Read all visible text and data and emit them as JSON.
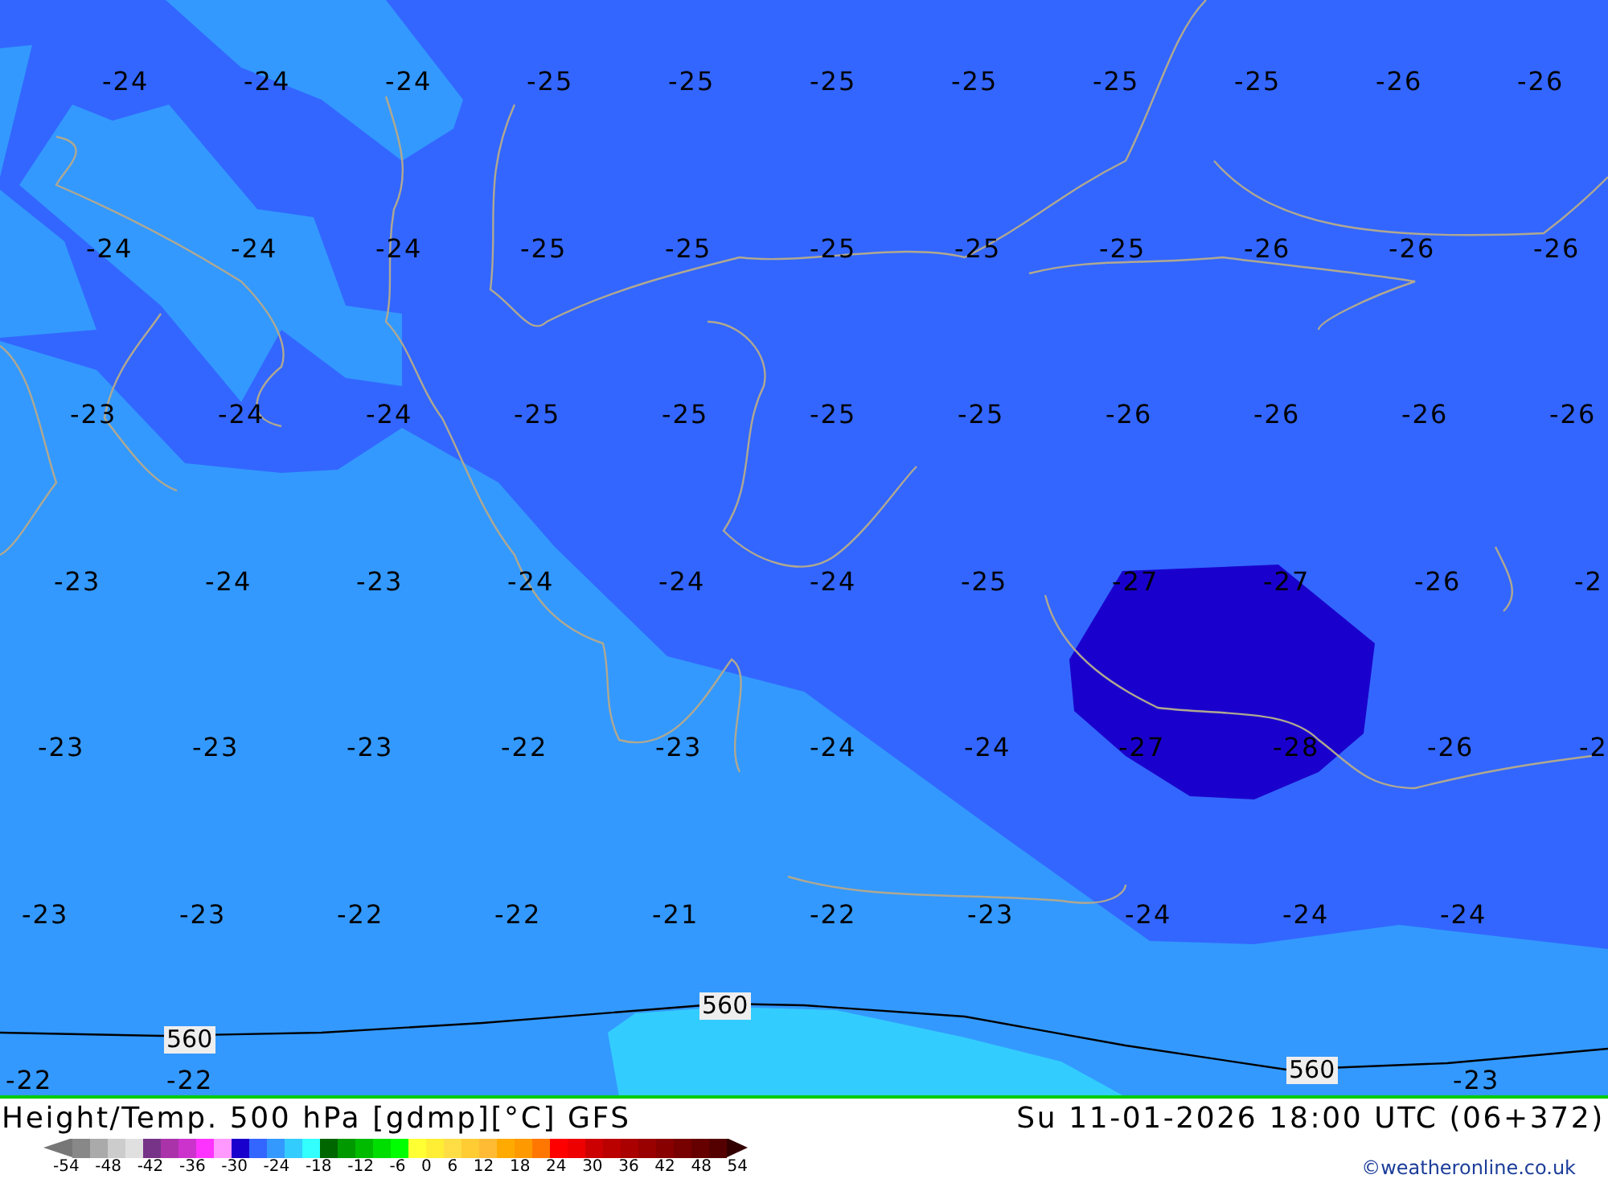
{
  "map": {
    "temperature_rows": [
      [
        "-24",
        "-24",
        "-24",
        "-25",
        "-25",
        "-25",
        "-25",
        "-25",
        "-25",
        "-26",
        "-26"
      ],
      [
        "-24",
        "-24",
        "-24",
        "-25",
        "-25",
        "-25",
        "-25",
        "-25",
        "-26",
        "-26",
        "-26"
      ],
      [
        "-23",
        "-24",
        "-24",
        "-25",
        "-25",
        "-25",
        "-25",
        "-26",
        "-26",
        "-26",
        "-26"
      ],
      [
        "-23",
        "-24",
        "-23",
        "-24",
        "-24",
        "-24",
        "-25",
        "-27",
        "-27",
        "-26",
        "-2"
      ],
      [
        "-23",
        "-23",
        "-23",
        "-22",
        "-23",
        "-24",
        "-24",
        "-27",
        "-28",
        "-26",
        "-2"
      ],
      [
        "-23",
        "-23",
        "-22",
        "-22",
        "-21",
        "-22",
        "-23",
        "-24",
        "-24",
        "-24",
        null
      ],
      [
        "-22",
        "-22",
        null,
        null,
        null,
        null,
        null,
        null,
        null,
        "-23",
        null
      ]
    ],
    "contour_labels": [
      "560",
      "560",
      "560"
    ]
  },
  "footer": {
    "title": "Height/Temp. 500 hPa [gdmp][°C] GFS",
    "valid_time": "Su 11-01-2026 18:00 UTC (06+372)",
    "legend": {
      "swatches": [
        {
          "kind": "arrow-left",
          "color": "#777777"
        },
        {
          "kind": "block",
          "color": "#888888"
        },
        {
          "kind": "block",
          "color": "#aaaaaa"
        },
        {
          "kind": "block",
          "color": "#cccccc"
        },
        {
          "kind": "block",
          "color": "#e0e0e0"
        },
        {
          "kind": "block",
          "color": "#773388"
        },
        {
          "kind": "block",
          "color": "#aa33aa"
        },
        {
          "kind": "block",
          "color": "#cc33cc"
        },
        {
          "kind": "block",
          "color": "#ff33ff"
        },
        {
          "kind": "block",
          "color": "#ff99ff"
        },
        {
          "kind": "block",
          "color": "#1a00cc"
        },
        {
          "kind": "block",
          "color": "#3366ff"
        },
        {
          "kind": "block",
          "color": "#3399ff"
        },
        {
          "kind": "block",
          "color": "#33ccff"
        },
        {
          "kind": "block",
          "color": "#33ffff"
        },
        {
          "kind": "block",
          "color": "#006600"
        },
        {
          "kind": "block",
          "color": "#009900"
        },
        {
          "kind": "block",
          "color": "#00bb00"
        },
        {
          "kind": "block",
          "color": "#00dd00"
        },
        {
          "kind": "block",
          "color": "#00ff00"
        },
        {
          "kind": "block",
          "color": "#ffff33"
        },
        {
          "kind": "block",
          "color": "#ffee33"
        },
        {
          "kind": "block",
          "color": "#ffdd44"
        },
        {
          "kind": "block",
          "color": "#ffcc33"
        },
        {
          "kind": "block",
          "color": "#ffbb33"
        },
        {
          "kind": "block",
          "color": "#ffaa00"
        },
        {
          "kind": "block",
          "color": "#ff9900"
        },
        {
          "kind": "block",
          "color": "#ff7700"
        },
        {
          "kind": "block",
          "color": "#ff0000"
        },
        {
          "kind": "block",
          "color": "#ee0000"
        },
        {
          "kind": "block",
          "color": "#cc0000"
        },
        {
          "kind": "block",
          "color": "#bb0000"
        },
        {
          "kind": "block",
          "color": "#aa0000"
        },
        {
          "kind": "block",
          "color": "#990000"
        },
        {
          "kind": "block",
          "color": "#880000"
        },
        {
          "kind": "block",
          "color": "#770000"
        },
        {
          "kind": "block",
          "color": "#660000"
        },
        {
          "kind": "block",
          "color": "#550000"
        },
        {
          "kind": "arrow-right",
          "color": "#330000"
        }
      ],
      "ticks": [
        "-54",
        "-48",
        "-42",
        "-36",
        "-30",
        "-24",
        "-18",
        "-12",
        "-6",
        "0",
        "6",
        "12",
        "18",
        "24",
        "30",
        "36",
        "42",
        "48",
        "54"
      ]
    },
    "credit": "©weatheronline.co.uk"
  }
}
